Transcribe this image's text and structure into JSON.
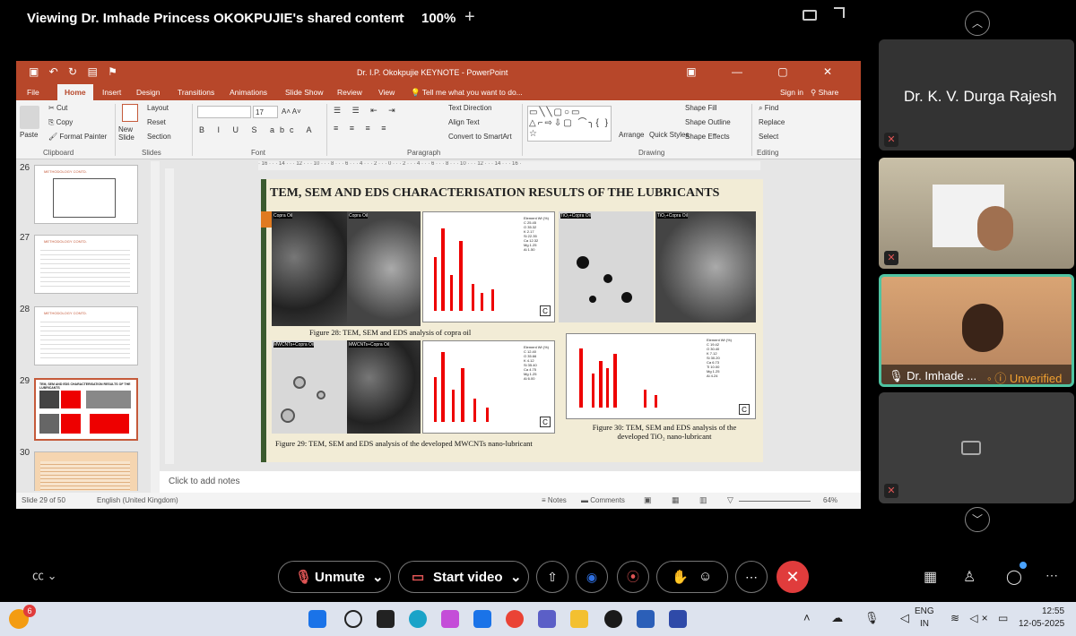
{
  "share_bar": {
    "title": "Viewing Dr. Imhade Princess OKOKPUJIE's shared content",
    "zoom_minus": "−",
    "zoom_level": "100%",
    "zoom_plus": "+"
  },
  "ppt": {
    "window_title": "Dr. I.P. Okokpujie KEYNOTE - PowerPoint",
    "tabs": [
      "File",
      "Home",
      "Insert",
      "Design",
      "Transitions",
      "Animations",
      "Slide Show",
      "Review",
      "View"
    ],
    "tell_me": "Tell me what you want to do...",
    "sign_in": "Sign in",
    "share": "Share",
    "ribbon": {
      "cut": "Cut",
      "copy": "Copy",
      "paste": "Paste",
      "format_painter": "Format Painter",
      "clipboard": "Clipboard",
      "new_slide": "New Slide",
      "layout": "Layout",
      "reset": "Reset",
      "section": "Section",
      "slides": "Slides",
      "font_size": "17",
      "font": "Font",
      "paragraph": "Paragraph",
      "text_direction": "Text Direction",
      "align_text": "Align Text",
      "convert_smartart": "Convert to SmartArt",
      "arrange": "Arrange",
      "quick_styles": "Quick Styles",
      "shape_fill": "Shape Fill",
      "shape_outline": "Shape Outline",
      "shape_effects": "Shape Effects",
      "drawing": "Drawing",
      "find": "Find",
      "replace": "Replace",
      "select": "Select",
      "editing": "Editing"
    },
    "ruler_text": "· 16 · · · 14 · · · 12 · · · 10 · · · 8 · · · 6 · · · 4 · · · 2 · · · 0 · · · 2 · · · 4 · · · 6 · · · 8 · · · 10 · · · 12 · · · 14 · · · 16 ·",
    "thumb_numbers": [
      "26",
      "27",
      "28",
      "29",
      "30"
    ],
    "thumb_titles": [
      "METHODOLOGY CONTD.",
      "METHODOLOGY CONTD.",
      "METHODOLOGY CONTD.",
      "TEM, SEM AND EDS CHARACTERISATION RESULTS OF THE LUBRICANTS",
      ""
    ],
    "slide": {
      "title": "TEM, SEM AND EDS CHARACTERISATION RESULTS OF THE LUBRICANTS",
      "caption_28": "Figure 28: TEM, SEM and EDS analysis of copra oil",
      "caption_29": "Figure 29: TEM, SEM and EDS analysis of the developed MWCNTs nano-lubricant",
      "caption_30": "Figure 30: TEM, SEM and EDS analysis of the developed TiO₂ nano-lubricant",
      "tag_copra": "Copra Oil",
      "tag_tio2": "TiO₂+Copra Oil",
      "tag_mwcnt": "MWCNTs+Copra Oil",
      "letter_c": "C",
      "letter_a": "A",
      "letter_b": "B",
      "eds_table_1": [
        "Element  Wt (%)",
        "C  25.45",
        "O  35.32",
        "K  2.17",
        "Si  22.35",
        "Ca  12.32",
        "Mg  1.25",
        "Al  1.50"
      ],
      "eds_table_2": [
        "Element  Wt (%)",
        "C  12.40",
        "O  35.66",
        "K  4.12",
        "Si  35.40",
        "Ca  4.75",
        "Mg  1.25",
        "Al  6.00"
      ],
      "eds_table_3": [
        "Element  Wt (%)",
        "C  19.42",
        "O  30.40",
        "K  7.12",
        "Si  30.20",
        "Ca  6.73",
        "Ti  10.00",
        "Mg  1.25",
        "Al  4.24"
      ]
    },
    "notes_placeholder": "Click to add notes",
    "status": {
      "slide_info": "Slide 29 of 50",
      "language": "English (United Kingdom)",
      "notes": "Notes",
      "comments": "Comments",
      "zoom": "64%"
    }
  },
  "participants": [
    {
      "name": "Dr. K. V. Durga Rajesh"
    },
    {
      "name": ""
    },
    {
      "name": "Dr. Imhade ...",
      "status": "Unverified"
    },
    {
      "name": ""
    }
  ],
  "controls": {
    "unmute": "Unmute",
    "start_video": "Start video"
  },
  "taskbar": {
    "badge": "6",
    "lang_top": "ENG",
    "lang_bottom": "IN",
    "time": "12:55",
    "date": "12-05-2025"
  },
  "colors": {
    "ppt_accent": "#b7472a",
    "active_speaker": "#4fc3a1",
    "end_call": "#e03c3c",
    "unverified": "#f0a030"
  }
}
